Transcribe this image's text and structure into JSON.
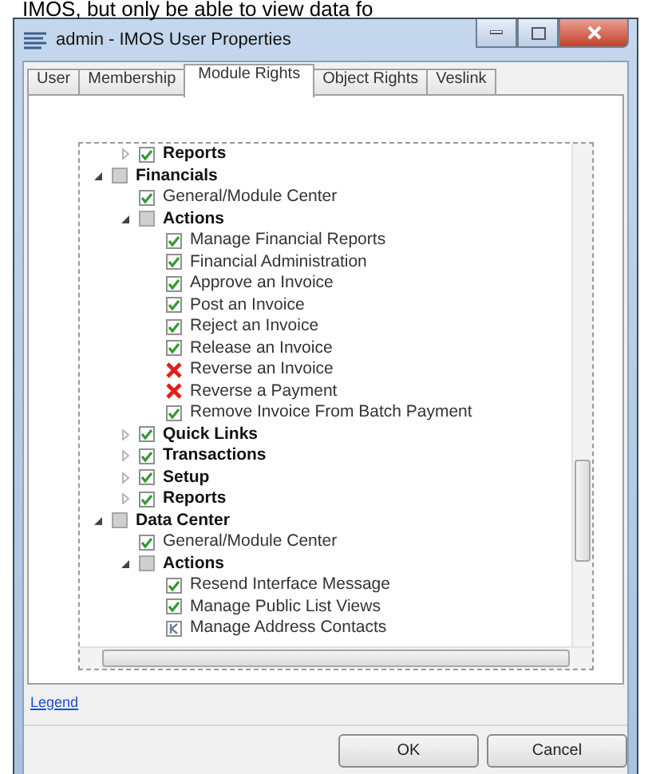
{
  "page_text": "IMOS, but only be able to view data fo",
  "window": {
    "title": "admin - IMOS User Properties"
  },
  "tabs": [
    {
      "label": "User",
      "selected": false
    },
    {
      "label": "Membership",
      "selected": false
    },
    {
      "label": "Module Rights",
      "selected": true
    },
    {
      "label": "Object Rights",
      "selected": false
    },
    {
      "label": "Veslink",
      "selected": false
    }
  ],
  "tree": [
    {
      "children": [
        {
          "label": "Reports",
          "kind": "checkbox",
          "checked": true,
          "expanded": false
        }
      ]
    },
    {
      "label": "Financials",
      "kind": "checkbox",
      "checked": false,
      "expanded": true,
      "children": [
        {
          "label": "General/Module Center",
          "kind": "checkbox",
          "checked": true
        },
        {
          "label": "Actions",
          "kind": "checkbox",
          "checked": false,
          "expanded": true,
          "children": [
            {
              "label": "Manage Financial Reports",
              "kind": "checkbox",
              "checked": true
            },
            {
              "label": "Financial Administration",
              "kind": "checkbox",
              "checked": true
            },
            {
              "label": "Approve an Invoice",
              "kind": "checkbox",
              "checked": true
            },
            {
              "label": "Post an Invoice",
              "kind": "checkbox",
              "checked": true
            },
            {
              "label": "Reject an Invoice",
              "kind": "checkbox",
              "checked": true
            },
            {
              "label": "Release an Invoice",
              "kind": "checkbox",
              "checked": true
            },
            {
              "label": "Reverse an Invoice",
              "kind": "deny"
            },
            {
              "label": "Reverse a Payment",
              "kind": "deny"
            },
            {
              "label": "Remove Invoice From Batch Payment",
              "kind": "checkbox",
              "checked": true
            }
          ]
        },
        {
          "label": "Quick Links",
          "kind": "checkbox",
          "checked": true,
          "expanded": false
        },
        {
          "label": "Transactions",
          "kind": "checkbox",
          "checked": true,
          "expanded": false
        },
        {
          "label": "Setup",
          "kind": "checkbox",
          "checked": true,
          "expanded": false
        },
        {
          "label": "Reports",
          "kind": "checkbox",
          "checked": true,
          "expanded": false
        }
      ]
    },
    {
      "label": "Data Center",
      "kind": "checkbox",
      "checked": false,
      "expanded": true,
      "children": [
        {
          "label": "General/Module Center",
          "kind": "checkbox",
          "checked": true
        },
        {
          "label": "Actions",
          "kind": "checkbox",
          "checked": false,
          "expanded": true,
          "children": [
            {
              "label": "Resend Interface Message",
              "kind": "checkbox",
              "checked": true
            },
            {
              "label": "Manage Public List Views",
              "kind": "checkbox",
              "checked": true
            },
            {
              "label": "Manage Address Contacts",
              "kind": "mixed"
            }
          ]
        }
      ]
    }
  ],
  "legend_link": "Legend",
  "buttons": [
    "OK",
    "Cancel"
  ]
}
